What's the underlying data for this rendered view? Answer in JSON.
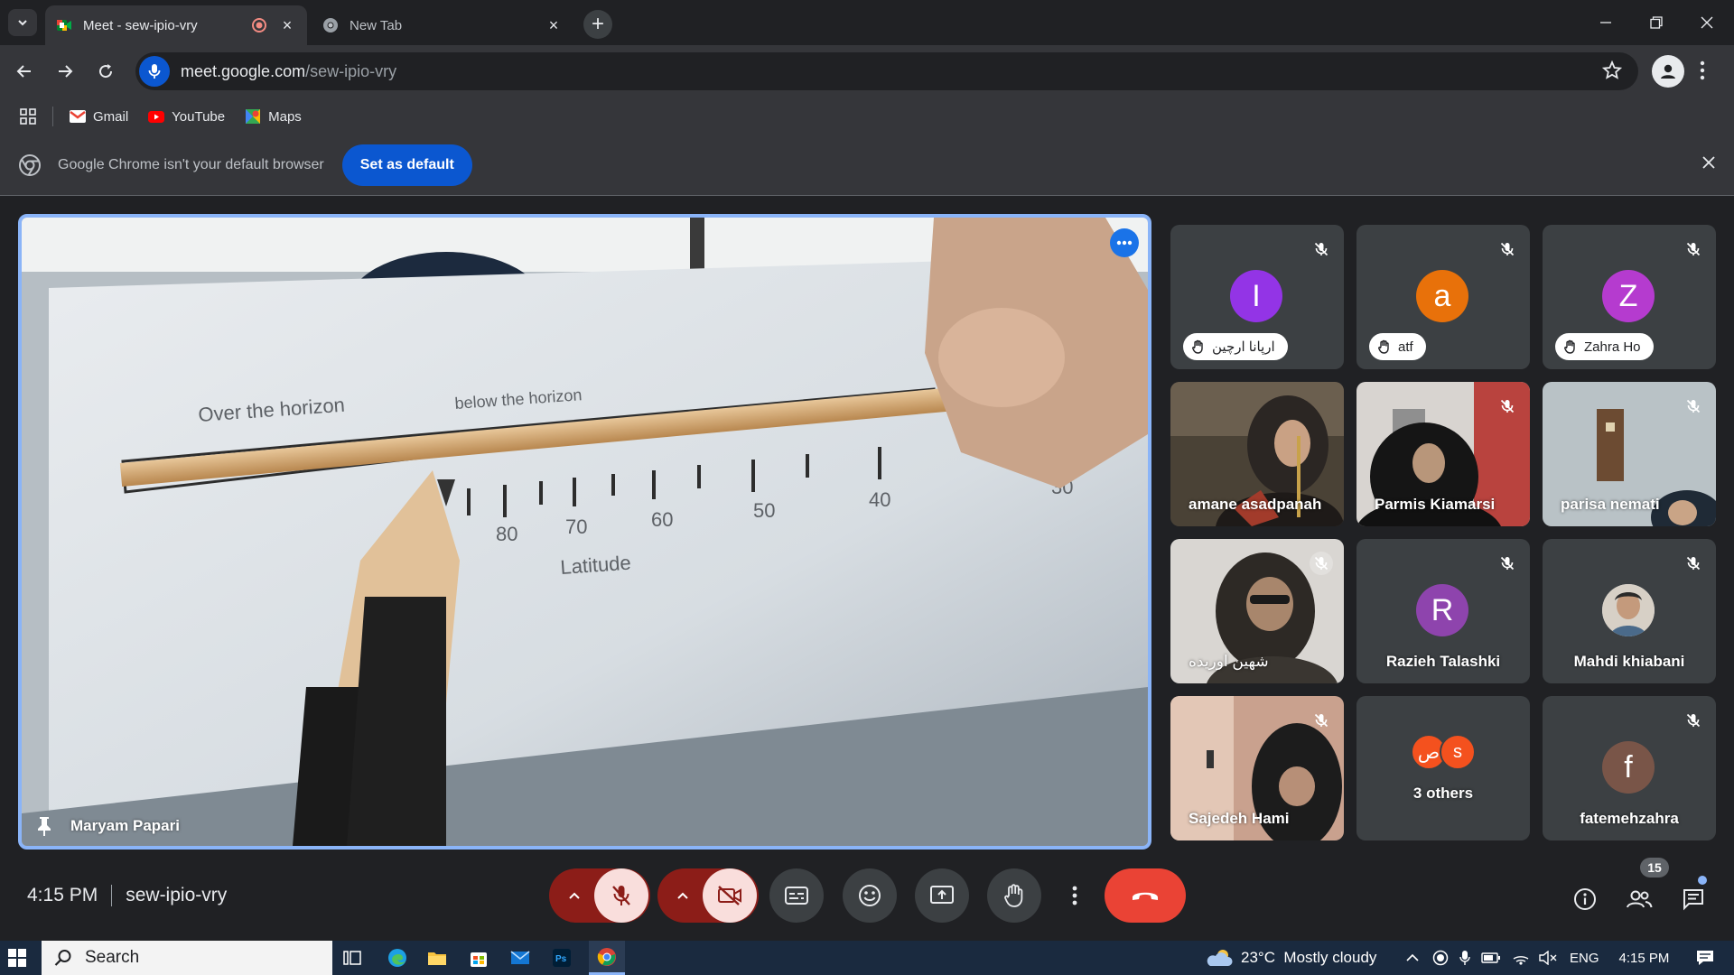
{
  "browser": {
    "tabs": [
      {
        "title": "Meet - sew-ipio-vry",
        "active": true
      },
      {
        "title": "New Tab",
        "active": false
      }
    ],
    "url_host": "meet.google.com",
    "url_path": "/sew-ipio-vry",
    "bookmarks": [
      {
        "label": "Gmail"
      },
      {
        "label": "YouTube"
      },
      {
        "label": "Maps"
      }
    ],
    "infobar": {
      "message": "Google Chrome isn't your default browser",
      "button": "Set as default"
    }
  },
  "meet": {
    "main_speaker": "Maryam Papari",
    "video_text": {
      "over": "Over the horizon",
      "below": "below the horizon",
      "latitude": "Latitude",
      "ticks": [
        "80",
        "70",
        "60",
        "50",
        "40",
        "30"
      ]
    },
    "participants": [
      {
        "name": "ارپانا ارچین",
        "initial": "I",
        "color": "#9334e6",
        "kind": "avatar-pill"
      },
      {
        "name": "atf",
        "initial": "a",
        "color": "#e8710a",
        "kind": "avatar-pill"
      },
      {
        "name": "Zahra Ho",
        "initial": "Z",
        "color": "#b53bcf",
        "kind": "avatar-pill"
      },
      {
        "name": "amane asadpanah",
        "kind": "video"
      },
      {
        "name": "Parmis Kiamarsi",
        "kind": "video"
      },
      {
        "name": "parisa nemati",
        "kind": "video"
      },
      {
        "name": "شهین اوریده",
        "kind": "video"
      },
      {
        "name": "Razieh Talashki",
        "initial": "R",
        "color": "#8e44ad",
        "kind": "avatar"
      },
      {
        "name": "Mahdi khiabani",
        "kind": "photo"
      },
      {
        "name": "Sajedeh Hami",
        "kind": "video"
      },
      {
        "name": "3 others",
        "initials": [
          "ص",
          "s"
        ],
        "kind": "others"
      },
      {
        "name": "fatemehzahra",
        "initial": "f",
        "color": "#795548",
        "kind": "avatar"
      }
    ],
    "time": "4:15 PM",
    "meeting_code": "sew-ipio-vry",
    "participant_count": "15"
  },
  "taskbar": {
    "search_placeholder": "Search",
    "weather": "23°C  Mostly cloudy",
    "language": "ENG",
    "clock": "4:15 PM"
  },
  "colors": {
    "accent": "#8ab4f8",
    "end_call": "#ea4335",
    "chrome_blue": "#0b57d0"
  }
}
